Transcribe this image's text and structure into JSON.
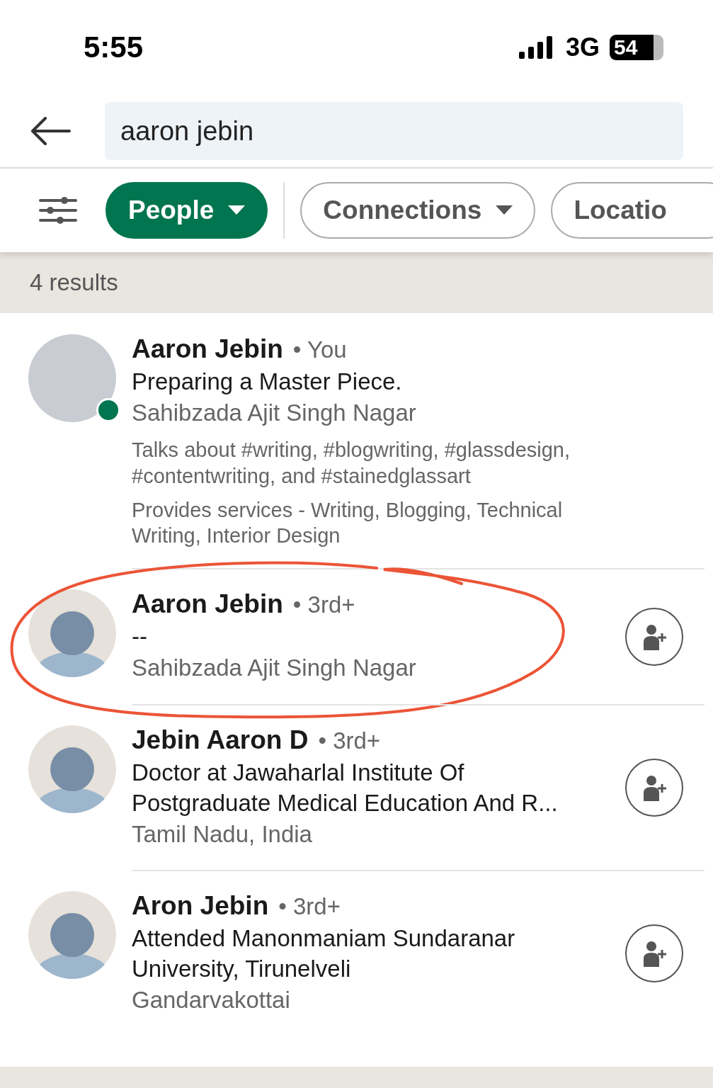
{
  "status_bar": {
    "time": "5:55",
    "network": "3G",
    "battery": "54"
  },
  "search": {
    "value": "aaron jebin"
  },
  "filters": [
    {
      "label": "People",
      "selected": true,
      "dropdown": true
    },
    {
      "label": "Connections",
      "selected": false,
      "dropdown": true
    },
    {
      "label": "Locatio",
      "selected": false,
      "dropdown": false
    }
  ],
  "results_count": "4 results",
  "results": [
    {
      "name": "Aaron Jebin",
      "degree": "• You",
      "avatar": {
        "kind": "photo",
        "online": true,
        "color": "#01754f"
      },
      "connect_button": false,
      "headline": "Preparing a Master Piece.",
      "location": "Sahibzada Ajit Singh Nagar",
      "details": [
        "Talks about #writing, #blogwriting, #glassdesign, #contentwriting, and #stainedglassart",
        "Provides services - Writing, Blogging, Technical Writing, Interior Design"
      ]
    },
    {
      "name": "Aaron Jebin",
      "degree": "• 3rd+",
      "avatar": {
        "kind": "placeholder",
        "online": false
      },
      "connect_button": true,
      "headline": "--",
      "location": "Sahibzada Ajit Singh Nagar",
      "circled": true
    },
    {
      "name": "Jebin Aaron D",
      "degree": "• 3rd+",
      "avatar": {
        "kind": "placeholder",
        "online": false
      },
      "connect_button": true,
      "headline": "Doctor at Jawaharlal Institute Of Postgraduate Medical Education And R...",
      "location": "Tamil Nadu, India"
    },
    {
      "name": "Aron Jebin",
      "degree": "• 3rd+",
      "avatar": {
        "kind": "placeholder",
        "online": false
      },
      "connect_button": true,
      "headline": "Attended Manonmaniam Sundaranar University, Tirunelveli",
      "location": "Gandarvakottai"
    }
  ]
}
